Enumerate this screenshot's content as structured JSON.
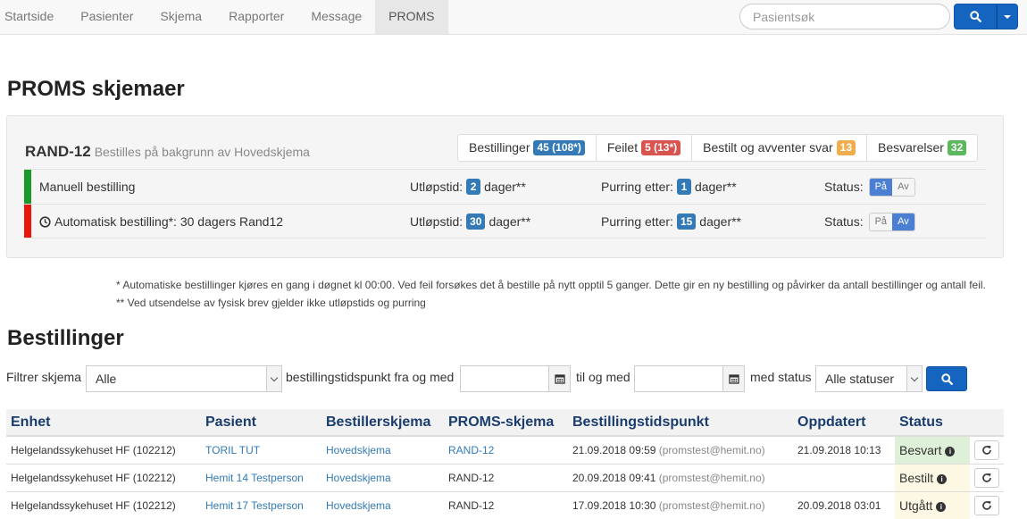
{
  "nav": {
    "items": [
      "Startside",
      "Pasienter",
      "Skjema",
      "Rapporter",
      "Message",
      "PROMS"
    ],
    "active_index": 5,
    "search_placeholder": "Pasientsøk",
    "search_icon": "search-icon"
  },
  "page_title": "PROMS skjemaer",
  "proms": {
    "form_name": "RAND-12",
    "form_subtitle": "Bestilles på bakgrunn av Hovedskjema",
    "tabs": [
      {
        "label": "Bestillinger",
        "badge": "45 (108*)",
        "color": "#337ab7"
      },
      {
        "label": "Feilet",
        "badge": "5 (13*)",
        "color": "#d9534f"
      },
      {
        "label": "Bestilt og avventer svar",
        "badge": "13",
        "color": "#f0ad4e"
      },
      {
        "label": "Besvarelser",
        "badge": "32",
        "color": "#5cb85c"
      }
    ],
    "rows": [
      {
        "name": "Manuell bestilling",
        "has_clock_icon": false,
        "accent": "#1a9a2a",
        "expiry_label": "Utløpstid:",
        "expiry_value": "2",
        "expiry_unit": "dager**",
        "reminder_label": "Purring etter:",
        "reminder_value": "1",
        "reminder_unit": "dager**",
        "status_label": "Status:",
        "on_label": "På",
        "off_label": "Av",
        "active": "on"
      },
      {
        "name": "Automatisk bestilling*: 30 dagers Rand12",
        "has_clock_icon": true,
        "accent": "#e8150c",
        "expiry_label": "Utløpstid:",
        "expiry_value": "30",
        "expiry_unit": "dager**",
        "reminder_label": "Purring etter:",
        "reminder_value": "15",
        "reminder_unit": "dager**",
        "status_label": "Status:",
        "on_label": "På",
        "off_label": "Av",
        "active": "off"
      }
    ]
  },
  "footnotes": [
    "* Automatiske bestillinger kjøres en gang i døgnet kl 00:00. Ved feil forsøkes det å bestille på nytt opptil 5 ganger. Dette gir en ny bestilling og påvirker da antall bestillinger og antall feil.",
    "** Ved utsendelse av fysisk brev gjelder ikke utløpstids og purring"
  ],
  "orders_title": "Bestillinger",
  "filter": {
    "form_label": "Filtrer skjema",
    "form_value": "Alle",
    "from_label": "bestillingstidspunkt fra og med",
    "from_value": "",
    "to_label": "til og med",
    "to_value": "",
    "status_label": "med status",
    "status_value": "Alle statuser"
  },
  "table": {
    "headers": [
      "Enhet",
      "Pasient",
      "Bestillerskjema",
      "PROMS-skjema",
      "Bestillingstidspunkt",
      "Oppdatert",
      "Status"
    ],
    "rows": [
      {
        "unit": "Helgelandssykehuset HF (102212)",
        "patient": "TORIL TUT",
        "order_form": "Hovedskjema",
        "proms_form": "RAND-12",
        "proms_link": true,
        "ordered_time": "21.09.2018 09:59",
        "ordered_by": "(promstest@hemit.no)",
        "updated": "21.09.2018 10:13",
        "status": "Besvart",
        "status_color": "#dff0d8"
      },
      {
        "unit": "Helgelandssykehuset HF (102212)",
        "patient": "Hemit 14 Testperson",
        "order_form": "Hovedskjema",
        "proms_form": "RAND-12",
        "proms_link": false,
        "ordered_time": "20.09.2018 09:41",
        "ordered_by": "(promstest@hemit.no)",
        "updated": "",
        "status": "Bestilt",
        "status_color": "#fcf8e3"
      },
      {
        "unit": "Helgelandssykehuset HF (102212)",
        "patient": "Hemit 17 Testperson",
        "order_form": "Hovedskjema",
        "proms_form": "RAND-12",
        "proms_link": false,
        "ordered_time": "17.09.2018 10:30",
        "ordered_by": "(promstest@hemit.no)",
        "updated": "20.09.2018 03:01",
        "status": "Utgått",
        "status_color": "#fcf8e3"
      }
    ]
  }
}
